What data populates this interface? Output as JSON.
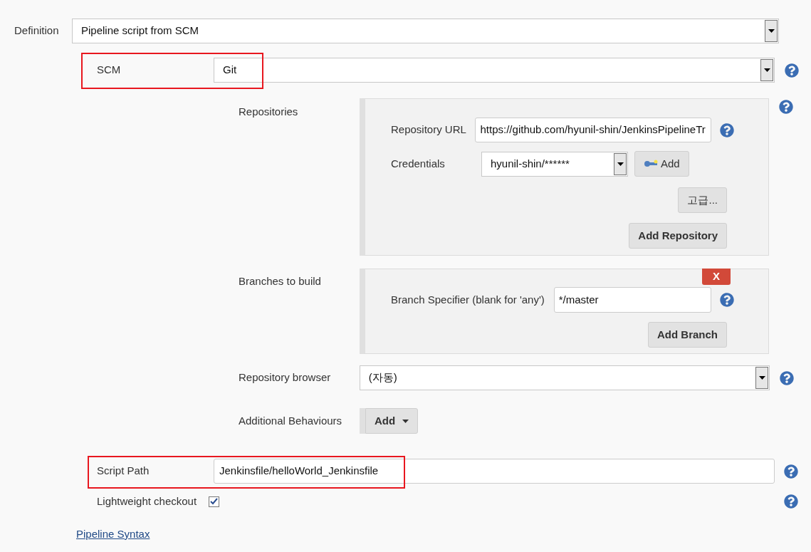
{
  "definition": {
    "label": "Definition",
    "value": "Pipeline script from SCM"
  },
  "scm": {
    "label": "SCM",
    "value": "Git",
    "highlighted": true
  },
  "repositories": {
    "label": "Repositories",
    "url_label": "Repository URL",
    "url": "https://github.com/hyunil-shin/JenkinsPipelineTr",
    "credentials_label": "Credentials",
    "credentials": "hyunil-shin/******",
    "add_credentials": "Add",
    "advanced": "고급...",
    "add_repository": "Add Repository"
  },
  "branches": {
    "label": "Branches to build",
    "delete": "X",
    "specifier_label": "Branch Specifier (blank for 'any')",
    "specifier": "*/master",
    "add_branch": "Add Branch"
  },
  "repository_browser": {
    "label": "Repository browser",
    "value": "(자동)"
  },
  "additional_behaviours": {
    "label": "Additional Behaviours",
    "add": "Add"
  },
  "script_path": {
    "label": "Script Path",
    "value": "Jenkinsfile/helloWorld_Jenkinsfile",
    "highlighted": true
  },
  "lightweight_checkout": {
    "label": "Lightweight checkout",
    "checked": true
  },
  "pipeline_syntax": "Pipeline Syntax"
}
